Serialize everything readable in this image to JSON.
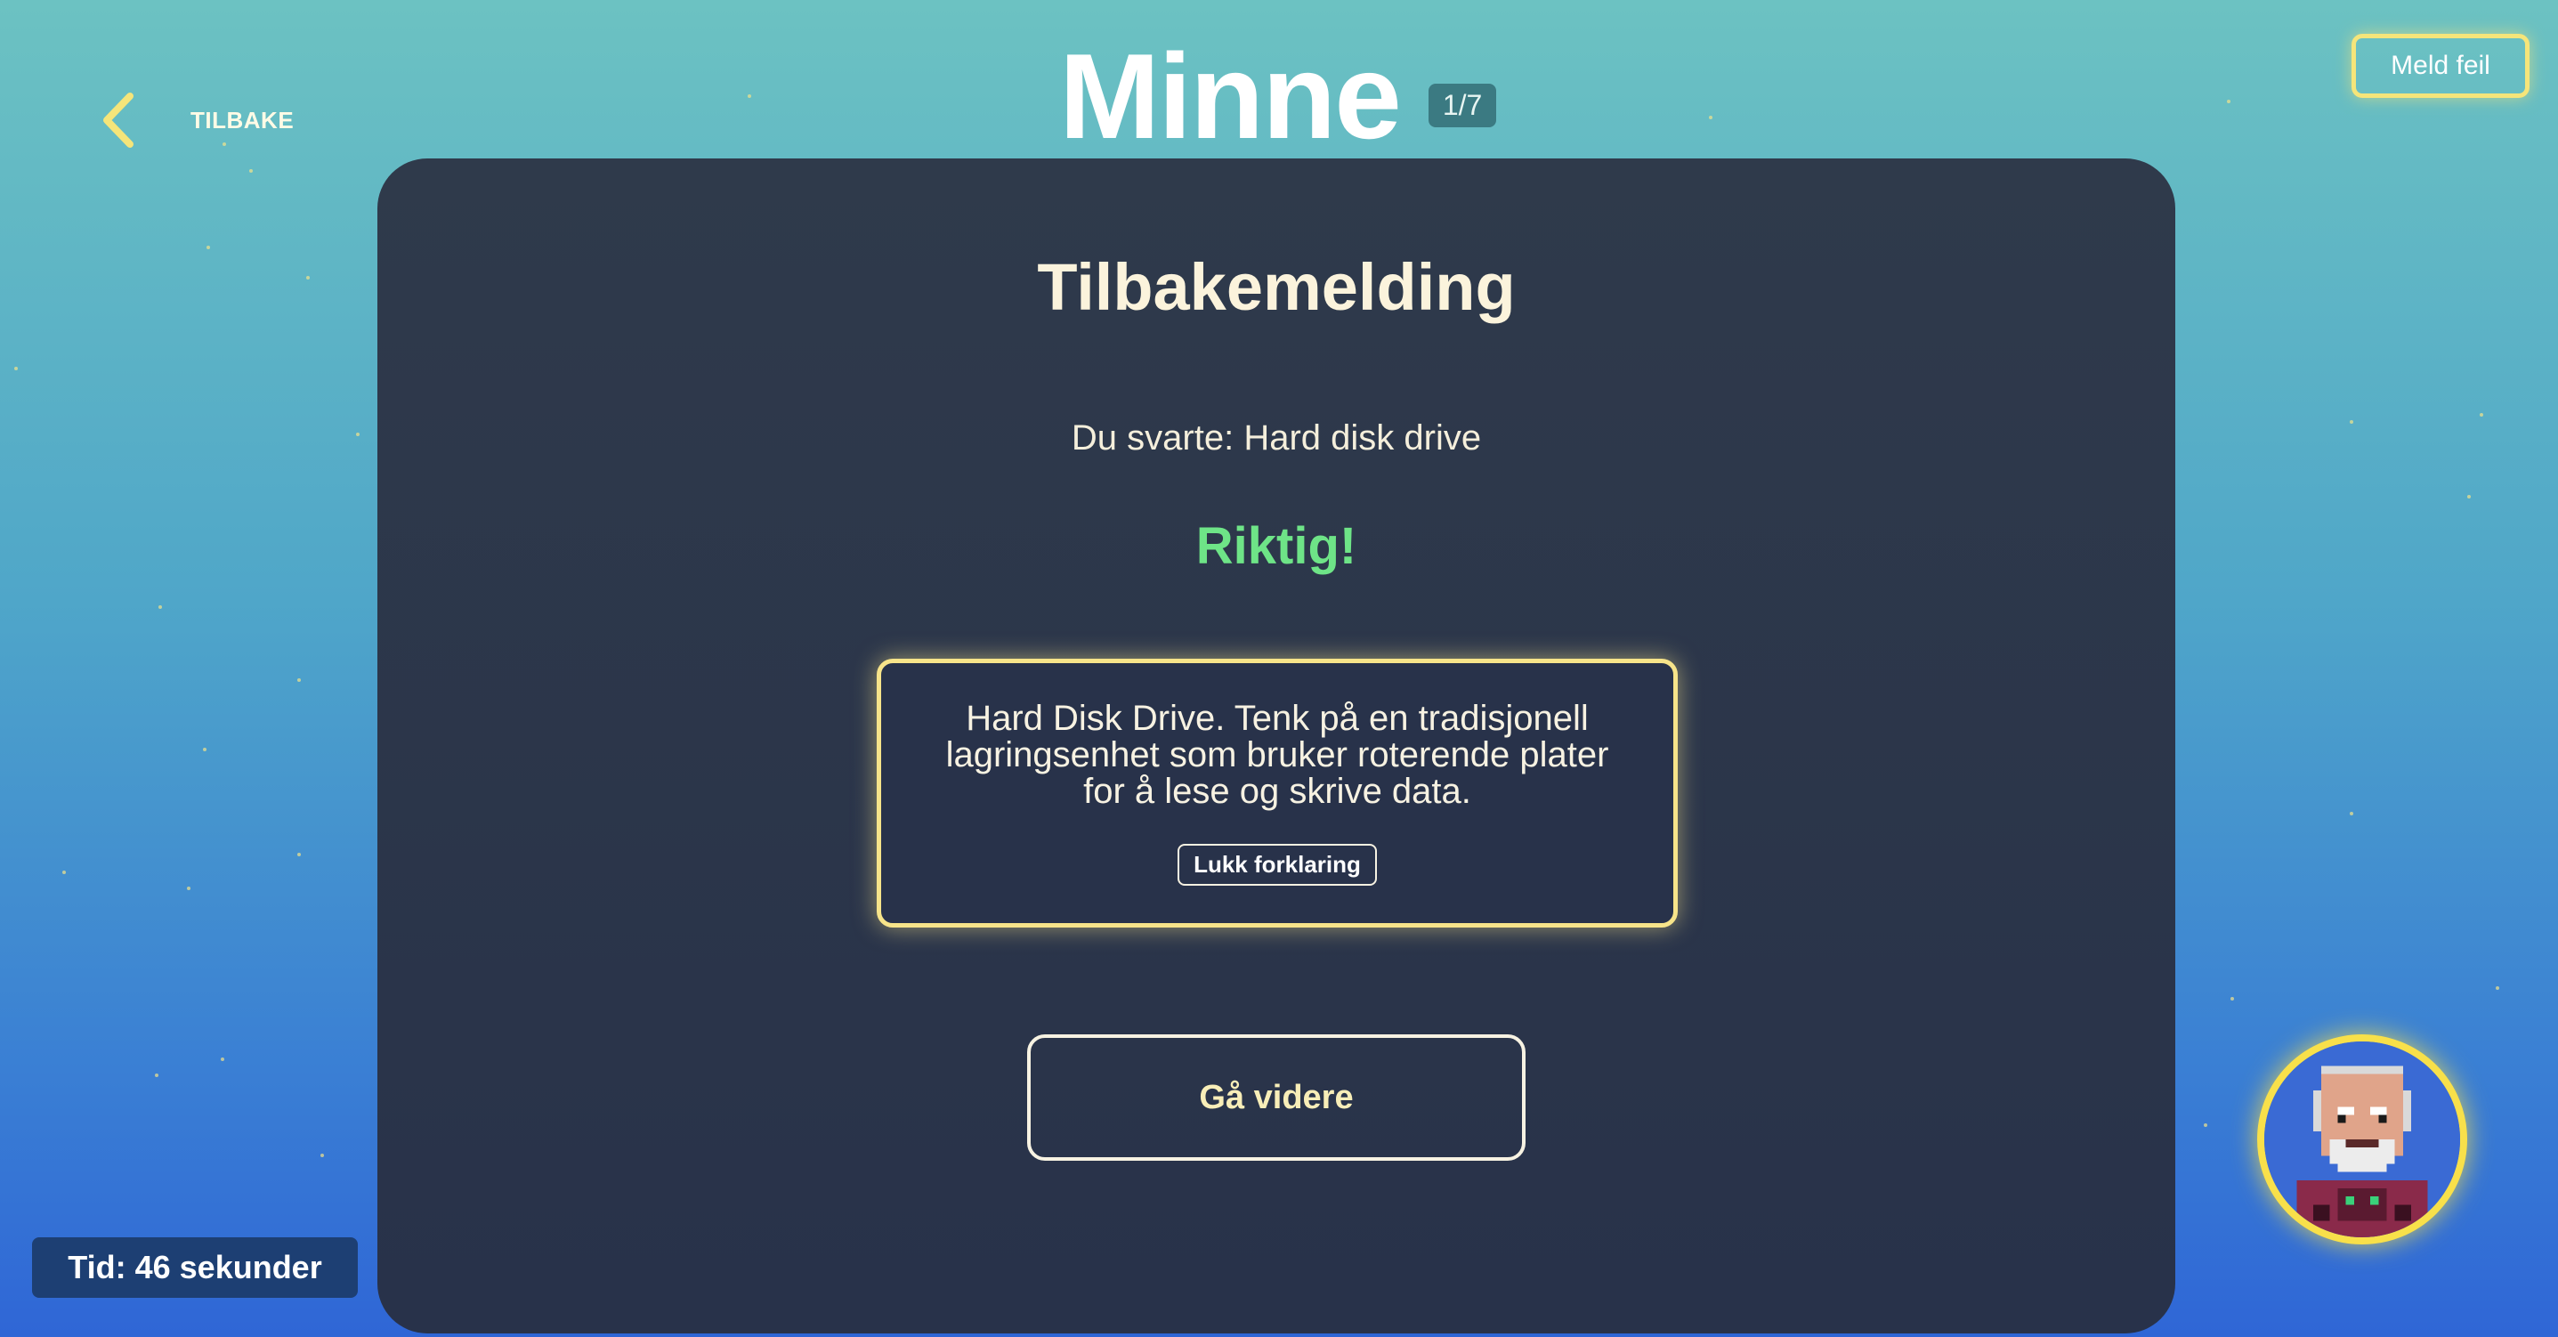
{
  "header": {
    "back_label": "TILBAKE",
    "title": "Minne",
    "counter": "1/7",
    "report_label": "Meld feil"
  },
  "card": {
    "title": "Tilbakemelding",
    "answer_text": "Du svarte: Hard disk drive",
    "result_text": "Riktig!",
    "explanation": "Hard Disk Drive. Tenk på en tradisjonell lagringsenhet som bruker roterende plater for å lese og skrive data.",
    "close_explanation_label": "Lukk forklaring",
    "next_label": "Gå videre"
  },
  "timer": {
    "text": "Tid: 46 sekunder"
  },
  "colors": {
    "accent_yellow": "#f5e57a",
    "correct_green": "#6ee487",
    "card_bg": "#2b3447"
  },
  "icons": {
    "back": "chevron-left-icon",
    "avatar": "pixel-avatar-old-man"
  }
}
